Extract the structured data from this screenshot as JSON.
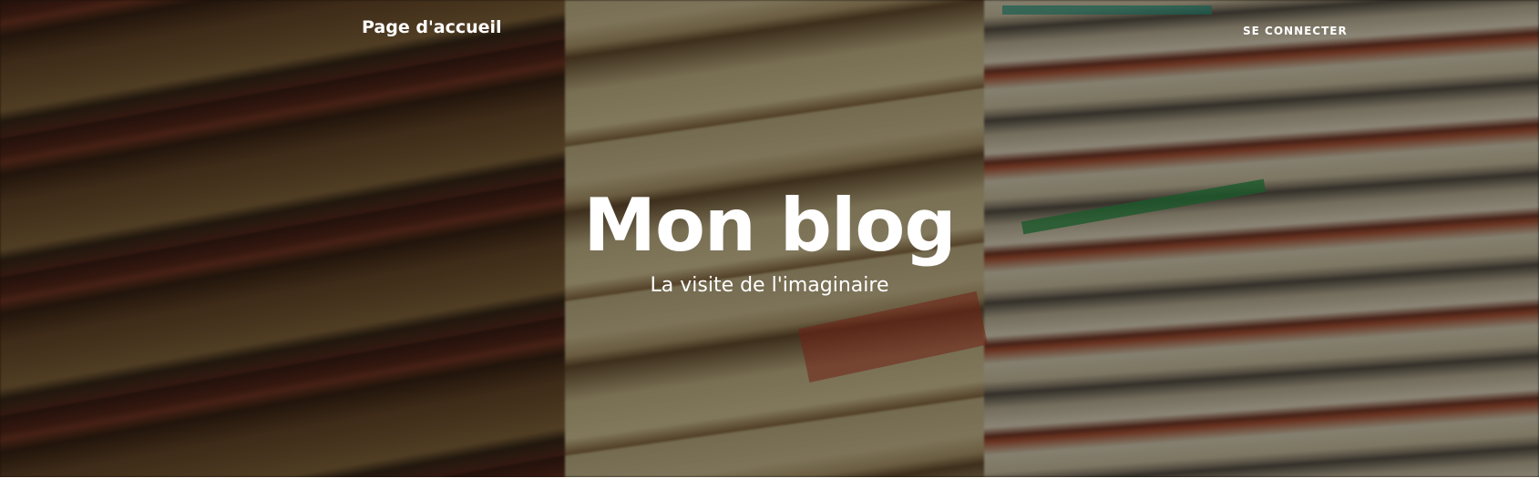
{
  "navbar": {
    "brand_label": "Page d'accueil",
    "login_label": "SE CONNECTER"
  },
  "header": {
    "title": "Mon blog",
    "subtitle": "La visite de l'imaginaire"
  },
  "colors": {
    "text": "#ffffff",
    "overlay": "#000000"
  }
}
